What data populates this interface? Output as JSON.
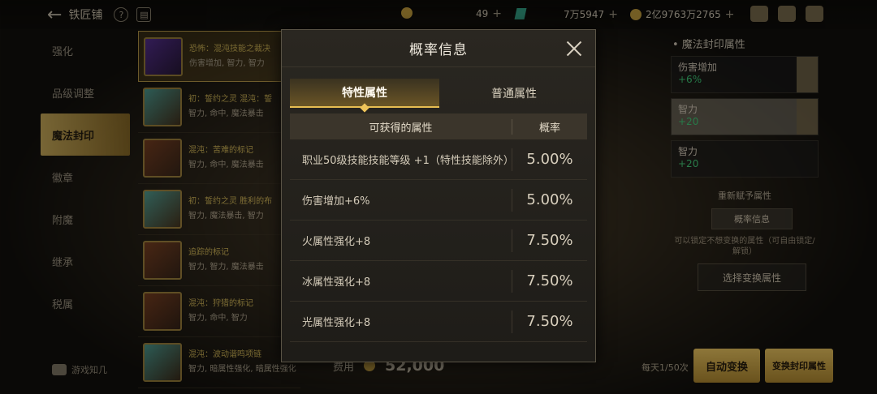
{
  "topbar": {
    "title": "铁匠铺",
    "currency1": "49",
    "currency2": "7万5947",
    "currency3": "2亿9763万2765"
  },
  "leftnav": {
    "items": [
      "强化",
      "品级调整",
      "魔法封印",
      "徽章",
      "附魔",
      "继承",
      "税属"
    ],
    "footer": "游戏知几"
  },
  "itemlist": [
    {
      "name": "恐怖：混沌技能之裁决",
      "desc": "伤害增加, 智力, 智力"
    },
    {
      "name": "初：誓约之灵 混沌：誓",
      "desc": "智力, 命中, 魔法暴击"
    },
    {
      "name": "混沌：苦难的标记",
      "desc": "智力, 命中, 魔法暴击"
    },
    {
      "name": "初：誓约之灵 胜利的布",
      "desc": "智力, 魔法暴击, 智力"
    },
    {
      "name": "追踪的标记",
      "desc": "智力, 智力, 魔法暴击"
    },
    {
      "name": "混沌：狩猎的标记",
      "desc": "智力, 命中, 智力"
    },
    {
      "name": "混沌：波动谐鸣项链",
      "desc": "智力, 暗属性强化, 暗属性强化"
    }
  ],
  "modal": {
    "title": "概率信息",
    "tabs": [
      "特性属性",
      "普通属性"
    ],
    "col_attr": "可获得的属性",
    "col_prob": "概率",
    "rows": [
      {
        "attr": "职业50级技能技能等级 +1（特性技能除外）",
        "prob": "5.00%"
      },
      {
        "attr": "伤害增加+6%",
        "prob": "5.00%"
      },
      {
        "attr": "火属性强化+8",
        "prob": "7.50%"
      },
      {
        "attr": "冰属性强化+8",
        "prob": "7.50%"
      },
      {
        "attr": "光属性强化+8",
        "prob": "7.50%"
      }
    ]
  },
  "rightpanel": {
    "title": "• 魔法封印属性",
    "cards": [
      {
        "name": "伤害增加",
        "value": "+6%"
      },
      {
        "name": "智力",
        "value": "+20"
      },
      {
        "name": "智力",
        "value": "+20"
      }
    ],
    "reassign": "重新赋予属性",
    "prob_btn": "概率信息",
    "note": "可以锁定不想变换的属性（可自由锁定/解锁）",
    "select_btn": "选择变换属性"
  },
  "bottom": {
    "cost_label": "费用",
    "cost_amount": "52,000",
    "daily": "每天1/50次",
    "auto_btn": "自动变换",
    "change_btn": "变换封印属性"
  }
}
